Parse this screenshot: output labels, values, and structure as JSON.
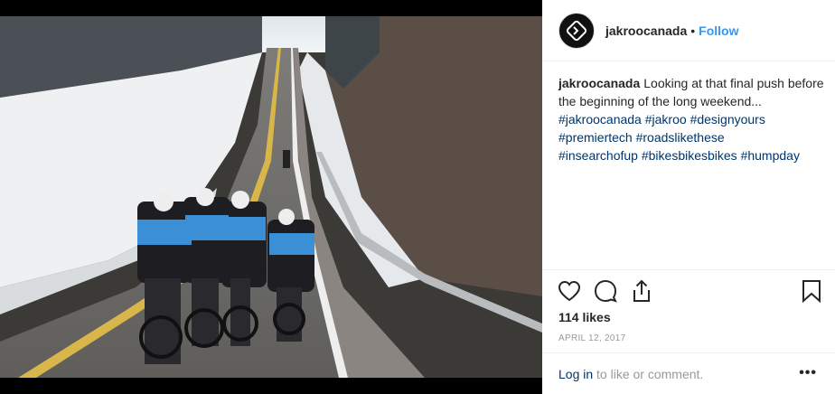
{
  "post": {
    "username": "jakroocanada",
    "separator": "•",
    "follow_label": "Follow",
    "caption_text": "Looking at that final push before the beginning of the long weekend...",
    "hashtags": [
      "#jakroocanada",
      "#jakroo",
      "#designyours",
      "#premiertech",
      "#roadslikethese",
      "#insearchofup",
      "#bikesbikesbikes",
      "#humpday"
    ],
    "likes": "114 likes",
    "date": "APRIL 12, 2017",
    "login_link": "Log in",
    "comment_prompt": " to like or comment.",
    "more_label": "•••"
  },
  "icons": {
    "avatar": "jakroo-logo-icon",
    "like": "heart-icon",
    "comment": "comment-icon",
    "share": "share-icon",
    "save": "bookmark-icon"
  },
  "colors": {
    "follow": "#3897f0",
    "hashtag": "#003569",
    "muted": "#999999",
    "text": "#262626"
  }
}
